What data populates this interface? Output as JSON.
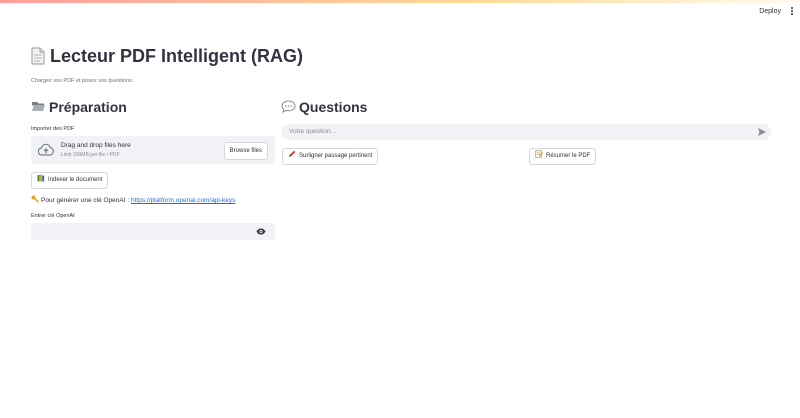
{
  "header": {
    "deploy_label": "Deploy",
    "menu_icon": "kebab-menu-icon"
  },
  "page": {
    "title": "Lecteur PDF Intelligent (RAG)",
    "subtitle": "Chargez vos PDF et posez vos questions."
  },
  "preparation": {
    "heading": "Préparation",
    "upload_label": "Importer des PDF",
    "dropzone_title": "Drag and drop files here",
    "dropzone_hint": "Limit 200MB per file • PDF",
    "browse_label": "Browse files",
    "index_button": "Indexer le document",
    "key_text": "Pour générer une clé OpenAI : ",
    "key_link": "https://platform.openai.com/api-keys",
    "key_input_label": "Entrer clé OpenAI",
    "key_input_value": ""
  },
  "questions": {
    "heading": "Questions",
    "chat_placeholder": "Votre question…",
    "highlight_button": "Surligner passage pertinent",
    "summary_button": "Résumer le PDF"
  },
  "colors": {
    "accent": "#ff4b4b",
    "link": "#1f6fd6",
    "input_bg": "#f0f2f6",
    "text": "#31333f"
  }
}
